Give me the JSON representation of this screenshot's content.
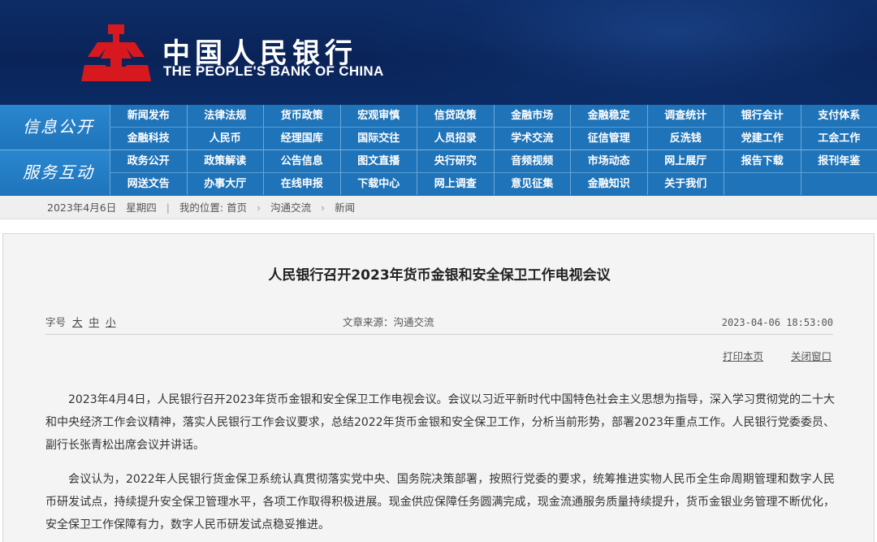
{
  "header": {
    "logo_cn": "中国人民银行",
    "logo_en": "THE PEOPLE'S BANK OF CHINA",
    "logo_icon": "pboc-emblem-icon",
    "brand_color": "#d7191f"
  },
  "nav": {
    "sections": [
      {
        "title": "信息公开",
        "rows": [
          [
            "新闻发布",
            "法律法规",
            "货币政策",
            "宏观审慎",
            "信贷政策",
            "金融市场",
            "金融稳定",
            "调查统计",
            "银行会计",
            "支付体系"
          ],
          [
            "金融科技",
            "人民币",
            "经理国库",
            "国际交往",
            "人员招录",
            "学术交流",
            "征信管理",
            "反洗钱",
            "党建工作",
            "工会工作"
          ]
        ]
      },
      {
        "title": "服务互动",
        "rows": [
          [
            "政务公开",
            "政策解读",
            "公告信息",
            "图文直播",
            "央行研究",
            "音频视频",
            "市场动态",
            "网上展厅",
            "报告下载",
            "报刊年鉴"
          ],
          [
            "网送文告",
            "办事大厅",
            "在线申报",
            "下载中心",
            "网上调查",
            "意见征集",
            "金融知识",
            "关于我们",
            "",
            ""
          ]
        ]
      }
    ]
  },
  "breadcrumb": {
    "date": "2023年4月6日",
    "weekday": "星期四",
    "location_label": "我的位置:",
    "items": [
      "首页",
      "沟通交流",
      "新闻"
    ]
  },
  "article": {
    "title": "人民银行召开2023年货币金银和安全保卫工作电视会议",
    "font_size_label": "字号",
    "font_sizes": [
      "大",
      "中",
      "小"
    ],
    "source": "文章来源：沟通交流",
    "timestamp": "2023-04-06 18:53:00",
    "print_label": "打印本页",
    "close_label": "关闭窗口",
    "paragraphs": [
      "2023年4月4日，人民银行召开2023年货币金银和安全保卫工作电视会议。会议以习近平新时代中国特色社会主义思想为指导，深入学习贯彻党的二十大和中央经济工作会议精神，落实人民银行工作会议要求，总结2022年货币金银和安全保卫工作，分析当前形势，部署2023年重点工作。人民银行党委委员、副行长张青松出席会议并讲话。",
      "会议认为，2022年人民银行货金保卫系统认真贯彻落实党中央、国务院决策部署，按照行党委的要求，统筹推进实物人民币全生命周期管理和数字人民币研发试点，持续提升安全保卫管理水平，各项工作取得积极进展。现金供应保障任务圆满完成，现金流通服务质量持续提升，货币金银业务管理不断优化，安全保卫工作保障有力，数字人民币研发试点稳妥推进。"
    ]
  }
}
